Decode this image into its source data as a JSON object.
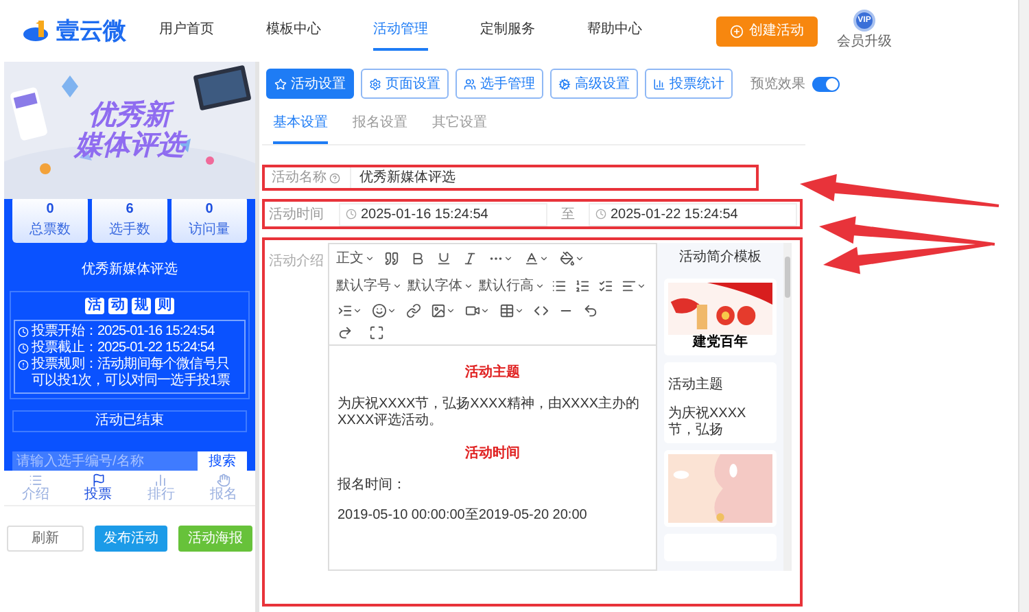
{
  "header": {
    "logo": "壹云微",
    "nav": [
      {
        "label": "用户首页",
        "selected": false
      },
      {
        "label": "模板中心",
        "selected": false
      },
      {
        "label": "活动管理",
        "selected": true
      },
      {
        "label": "定制服务",
        "selected": false
      },
      {
        "label": "帮助中心",
        "selected": false
      }
    ],
    "create_button": "创建活动",
    "vip_badge": "VIP",
    "vip_label": "会员升级"
  },
  "preview": {
    "banner_title": [
      "优秀新",
      "媒体评选"
    ],
    "stats": [
      {
        "value": "0",
        "label": "总票数"
      },
      {
        "value": "6",
        "label": "选手数"
      },
      {
        "value": "0",
        "label": "访问量"
      }
    ],
    "title": "优秀新媒体评选",
    "rules_heading": [
      "活",
      "动",
      "规",
      "则"
    ],
    "rules": [
      "投票开始：2025-01-16 15:24:54",
      "投票截止：2025-01-22 15:24:54",
      "投票规则：活动期间每个微信号只可以投1次，可以对同一选手投1票"
    ],
    "status": "活动已结束",
    "search": {
      "placeholder": "请输入选手编号/名称",
      "button": "搜索"
    },
    "bottom_nav": [
      {
        "label": "介绍",
        "selected": false
      },
      {
        "label": "投票",
        "selected": true
      },
      {
        "label": "排行",
        "selected": false
      },
      {
        "label": "报名",
        "selected": false
      }
    ],
    "buttons": [
      "刷新",
      "发布活动",
      "活动海报"
    ]
  },
  "tabs": [
    {
      "label": "活动设置",
      "selected": true
    },
    {
      "label": "页面设置",
      "selected": false
    },
    {
      "label": "选手管理",
      "selected": false
    },
    {
      "label": "高级设置",
      "selected": false
    },
    {
      "label": "投票统计",
      "selected": false
    }
  ],
  "preview_toggle": {
    "label": "预览效果",
    "on": true
  },
  "subtabs": [
    {
      "label": "基本设置",
      "selected": true
    },
    {
      "label": "报名设置",
      "selected": false
    },
    {
      "label": "其它设置",
      "selected": false
    }
  ],
  "form": {
    "name_label": "活动名称",
    "name_value": "优秀新媒体评选",
    "time_label": "活动时间",
    "start": "2025-01-16 15:24:54",
    "separator": "至",
    "end": "2025-01-22 15:24:54",
    "intro_label": "活动介绍"
  },
  "editor": {
    "dropdowns": [
      "正文",
      "默认字号",
      "默认字体",
      "默认行高"
    ],
    "content": [
      {
        "kind": "heading",
        "text": "活动主题"
      },
      {
        "kind": "paragraph",
        "text": "为庆祝XXXX节，弘扬XXXX精神，由XXXX主办的XXXX评选活动。"
      },
      {
        "kind": "heading",
        "text": "活动时间"
      },
      {
        "kind": "paragraph",
        "text": "报名时间："
      },
      {
        "kind": "paragraph",
        "text": "2019-05-10 00:00:00至2019-05-20 20:00"
      }
    ]
  },
  "templates": {
    "title": "活动简介模板",
    "cards": [
      {
        "kind": "picture",
        "caption": "建党百年"
      },
      {
        "kind": "text",
        "heading": "活动主题",
        "text": "为庆祝XXXX节，弘扬"
      },
      {
        "kind": "picture"
      },
      {
        "kind": "empty"
      }
    ]
  }
}
